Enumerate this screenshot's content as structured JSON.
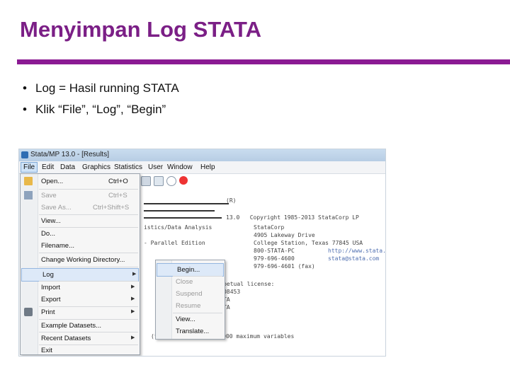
{
  "slide": {
    "title": "Menyimpan Log STATA",
    "bullets": [
      "Log = Hasil running STATA",
      "Klik “File”, “Log”, “Begin”"
    ]
  },
  "window": {
    "title": "Stata/MP 13.0 - [Results]",
    "menubar": [
      "File",
      "Edit",
      "Data",
      "Graphics",
      "Statistics",
      "User",
      "Window",
      "Help"
    ]
  },
  "file_menu": {
    "items": [
      {
        "label": "Open...",
        "shortcut": "Ctrl+O"
      },
      {
        "label": "Save",
        "shortcut": "Ctrl+S"
      },
      {
        "label": "Save As...",
        "shortcut": "Ctrl+Shift+S"
      },
      {
        "label": "View..."
      },
      {
        "label": "Do..."
      },
      {
        "label": "Filename..."
      },
      {
        "label": "Change Working Directory..."
      },
      {
        "label": "Log"
      },
      {
        "label": "Import"
      },
      {
        "label": "Export"
      },
      {
        "label": "Print"
      },
      {
        "label": "Example Datasets..."
      },
      {
        "label": "Recent Datasets"
      },
      {
        "label": "Exit"
      }
    ]
  },
  "log_submenu": {
    "items": [
      "Begin...",
      "Close",
      "Suspend",
      "Resume",
      "View...",
      "Translate..."
    ]
  },
  "results": {
    "lines": [
      "(R)",
      "13.0   Copyright 1985-2013 StataCorp LP",
      "istics/Data Analysis",
      "StataCorp",
      "4905 Lakeway Drive",
      "- Parallel Edition",
      "College Station, Texas 77845 USA",
      "800-STATA-PC",
      "http://www.stata.com",
      "979-696-4600",
      "stata@stata.com",
      "979-696-4601 (fax)",
      "k perpetual license:",
      "1306208453",
      "ER-UGTA",
      "ER-UGTA",
      "(*) ... set maxvar) 5000 maximum variables"
    ]
  },
  "colors": {
    "title": "#7b1f86",
    "rule": "#8b1a93",
    "highlight": "#dde9f8"
  }
}
